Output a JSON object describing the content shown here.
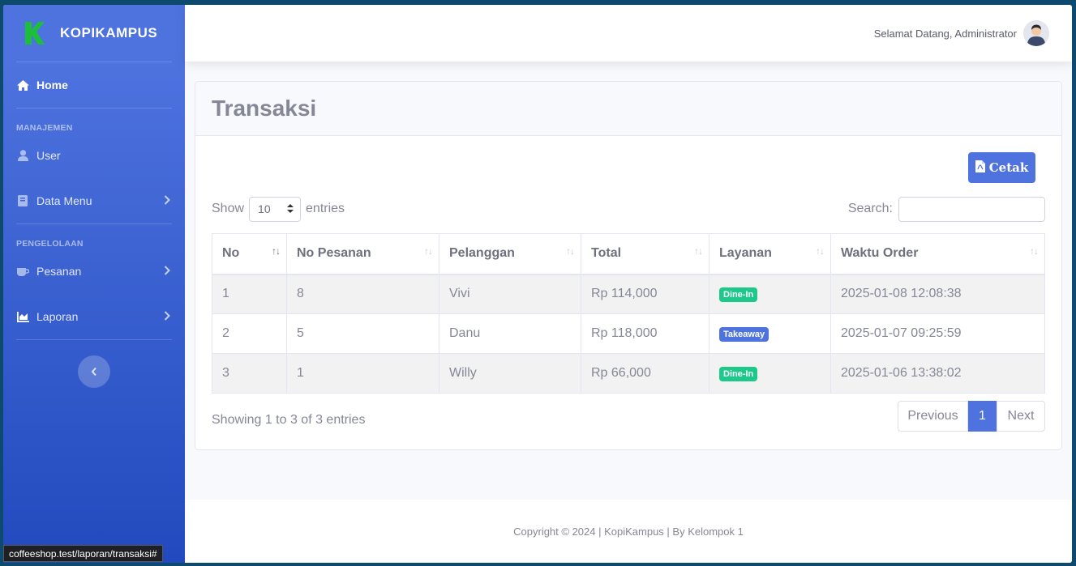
{
  "brand": {
    "name": "KOPIKAMPUS"
  },
  "sidebar": {
    "home": "Home",
    "heading_manajemen": "MANAJEMEN",
    "user": "User",
    "data_menu": "Data Menu",
    "heading_pengelolaan": "PENGELOLAAN",
    "pesanan": "Pesanan",
    "laporan": "Laporan"
  },
  "topbar": {
    "welcome": "Selamat Datang, Administrator"
  },
  "page": {
    "title": "Transaksi",
    "print_button": "Cetak",
    "show_label": "Show",
    "entries_value": "10",
    "entries_label": "entries",
    "search_label": "Search:"
  },
  "table": {
    "headers": [
      "No",
      "No Pesanan",
      "Pelanggan",
      "Total",
      "Layanan",
      "Waktu Order"
    ],
    "rows": [
      {
        "no": "1",
        "no_pesanan": "8",
        "pelanggan": "Vivi",
        "total": "Rp 114,000",
        "layanan": "Dine-In",
        "waktu": "2025-01-08 12:08:38"
      },
      {
        "no": "2",
        "no_pesanan": "5",
        "pelanggan": "Danu",
        "total": "Rp 118,000",
        "layanan": "Takeaway",
        "waktu": "2025-01-07 09:25:59"
      },
      {
        "no": "3",
        "no_pesanan": "1",
        "pelanggan": "Willy",
        "total": "Rp 66,000",
        "layanan": "Dine-In",
        "waktu": "2025-01-06 13:38:02"
      }
    ]
  },
  "pagination": {
    "info": "Showing 1 to 3 of 3 entries",
    "previous": "Previous",
    "current": "1",
    "next": "Next"
  },
  "footer": {
    "text": "Copyright © 2024 | KopiKampus | By Kelompok 1"
  },
  "statusbar": {
    "url": "coffeeshop.test/laporan/transaksi#"
  },
  "colors": {
    "primary": "#4e73df",
    "success": "#1cc88a",
    "brand_green": "#1dbf3a"
  }
}
